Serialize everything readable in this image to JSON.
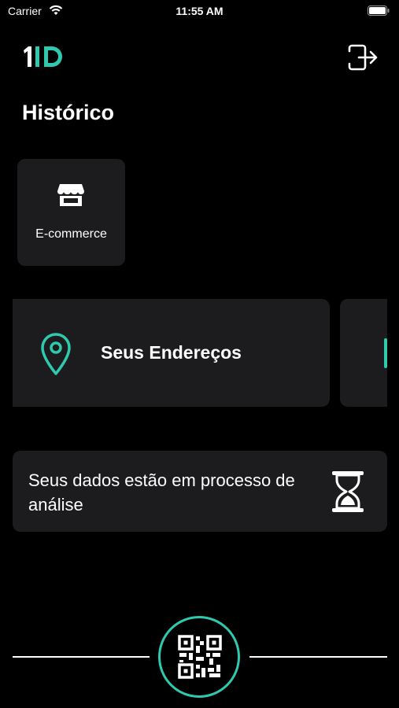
{
  "status_bar": {
    "carrier": "Carrier",
    "time": "11:55 AM"
  },
  "header": {
    "logo_text": "1ID",
    "logout_icon": "logout-icon"
  },
  "page": {
    "title": "Histórico"
  },
  "ecommerce_card": {
    "label": "E-commerce",
    "icon": "store-icon"
  },
  "carousel": {
    "items": [
      {
        "label": "Seus Endereços",
        "icon": "map-pin-icon"
      }
    ]
  },
  "status_card": {
    "text": "Seus dados estão em processo de análise",
    "icon": "hourglass-icon"
  },
  "bottom_bar": {
    "center_button_icon": "qr-code-icon"
  },
  "colors": {
    "background": "#000000",
    "card": "#1c1c1e",
    "accent": "#2ec9ae",
    "text": "#ffffff"
  }
}
